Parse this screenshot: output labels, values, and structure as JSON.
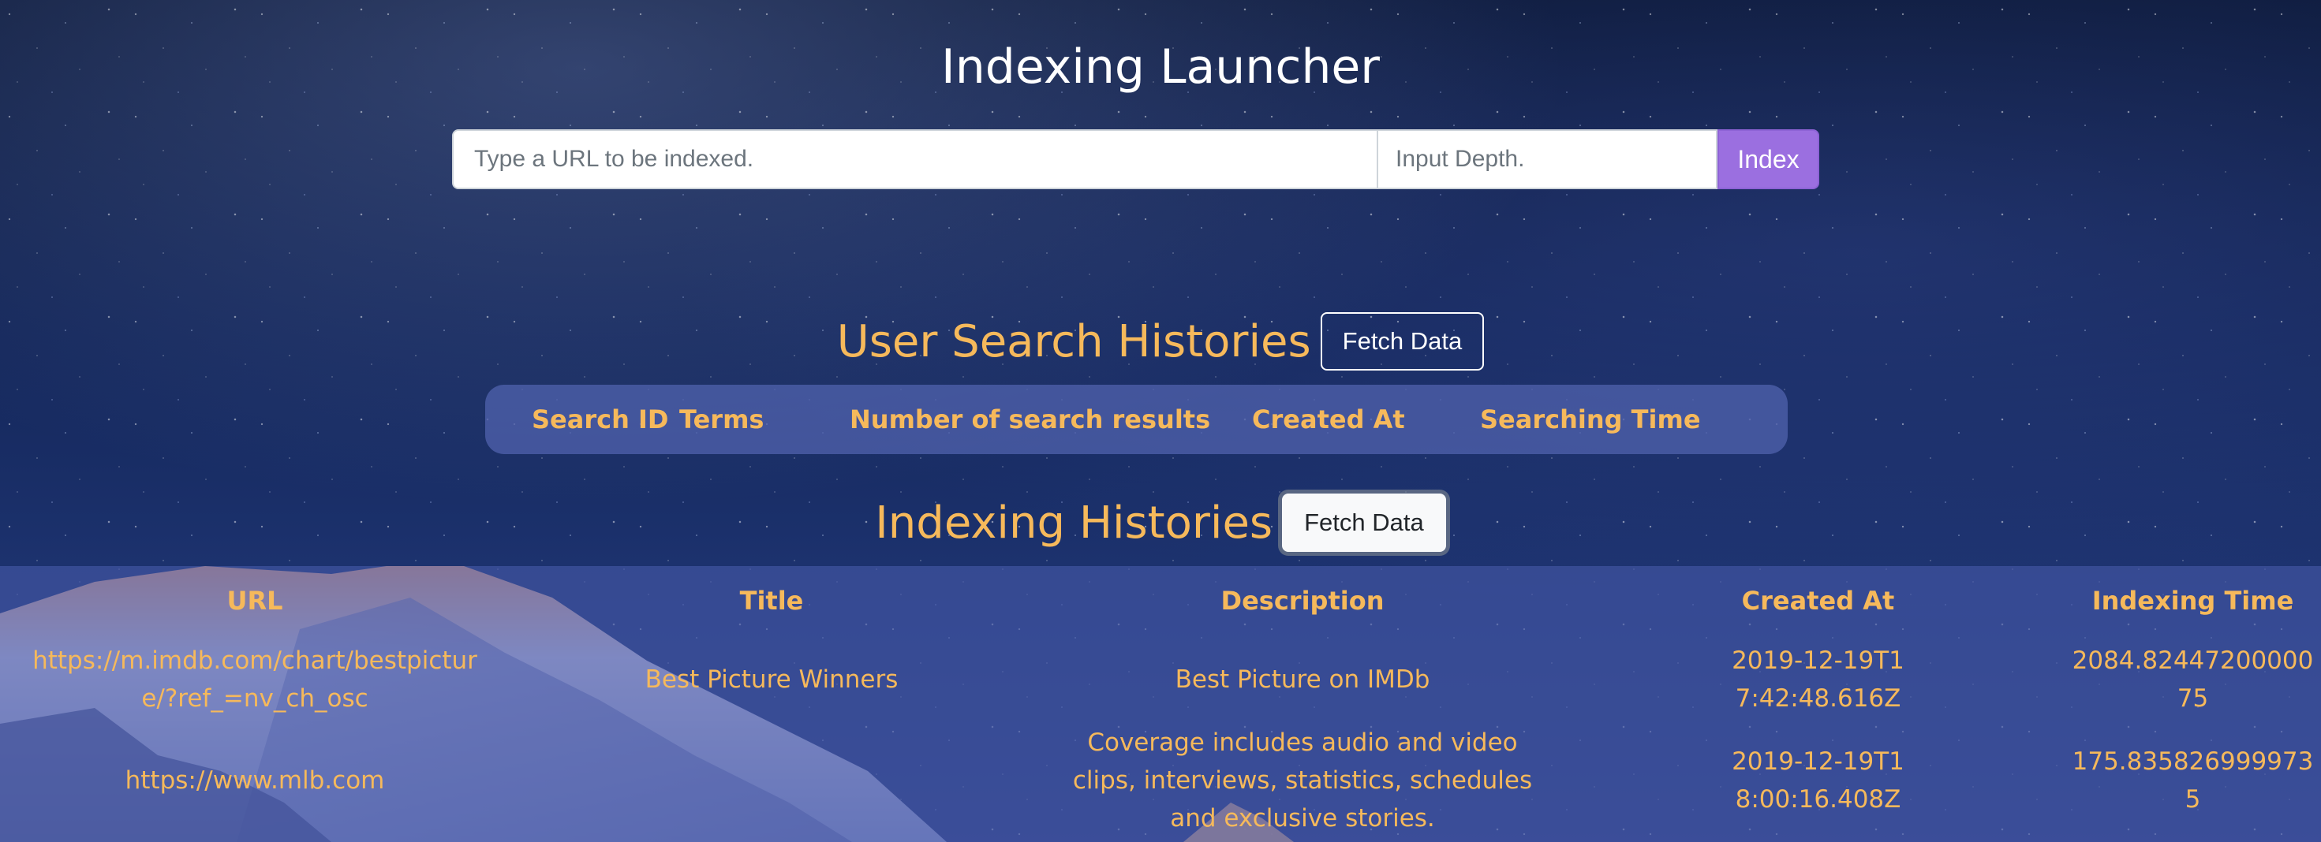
{
  "launcher": {
    "title": "Indexing Launcher",
    "url_placeholder": "Type a URL to be indexed.",
    "depth_placeholder": "Input Depth.",
    "index_label": "Index"
  },
  "user_search": {
    "title": "User Search Histories",
    "fetch_label": "Fetch Data",
    "columns": [
      "Search ID",
      "Terms",
      "Number of search results",
      "Created At",
      "Searching Time"
    ]
  },
  "indexing": {
    "title": "Indexing Histories",
    "fetch_label": "Fetch Data",
    "columns": [
      "URL",
      "Title",
      "Description",
      "Created At",
      "Indexing Time"
    ],
    "rows": [
      {
        "url": "https://m.imdb.com/chart/bestpicture/?ref_=nv_ch_osc",
        "title": "Best Picture Winners",
        "description": "Best Picture on IMDb",
        "created_at": "2019-12-19T17:42:48.616Z",
        "indexing_time": "2084.8244720000075"
      },
      {
        "url": "https://www.mlb.com",
        "title": "",
        "description": "Coverage includes audio and video clips, interviews, statistics, schedules and exclusive stories.",
        "created_at": "2019-12-19T18:00:16.408Z",
        "indexing_time": "175.8358269999735"
      }
    ]
  },
  "theme": {
    "accent": "#f6b95b",
    "index_button": "#9b6fe0",
    "header_band": "#4e60aa"
  }
}
